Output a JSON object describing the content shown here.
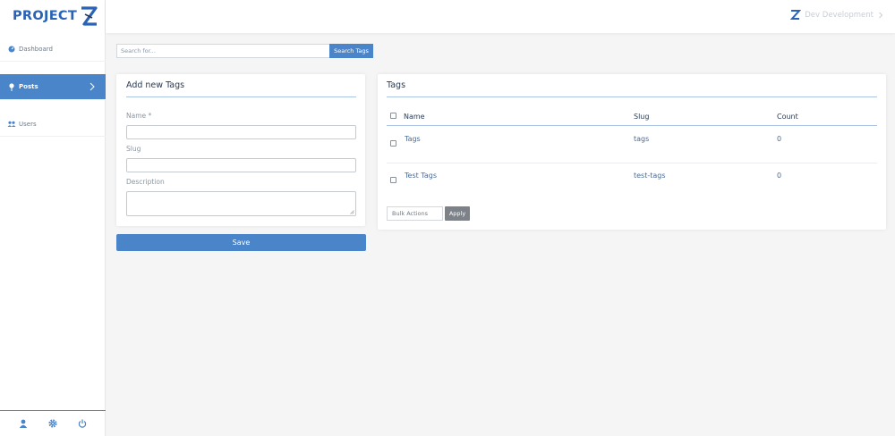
{
  "brand": {
    "name": "PROJECT",
    "color": "#2a63b6",
    "accent": "#4a85c9"
  },
  "sidebar": {
    "items": [
      {
        "label": "Dashboard",
        "icon": "dashboard-icon"
      },
      {
        "label": "Posts",
        "icon": "pin-icon",
        "active": true
      },
      {
        "label": "Users",
        "icon": "users-icon"
      }
    ],
    "footer_icons": [
      "user-icon",
      "gear-icon",
      "power-icon"
    ]
  },
  "topbar": {
    "user_label": "Dev Development"
  },
  "search": {
    "placeholder": "Search for...",
    "button_label": "Search Tags"
  },
  "add_form": {
    "title": "Add new Tags",
    "name_label": "Name *",
    "slug_label": "Slug",
    "description_label": "Description",
    "save_label": "Save"
  },
  "tags_table": {
    "title": "Tags",
    "columns": [
      "Name",
      "Slug",
      "Count"
    ],
    "rows": [
      {
        "name": "Tags",
        "slug": "tags",
        "count": "0"
      },
      {
        "name": "Test Tags",
        "slug": "test-tags",
        "count": "0"
      }
    ],
    "bulk_actions_label": "Bulk Actions",
    "apply_label": "Apply"
  }
}
